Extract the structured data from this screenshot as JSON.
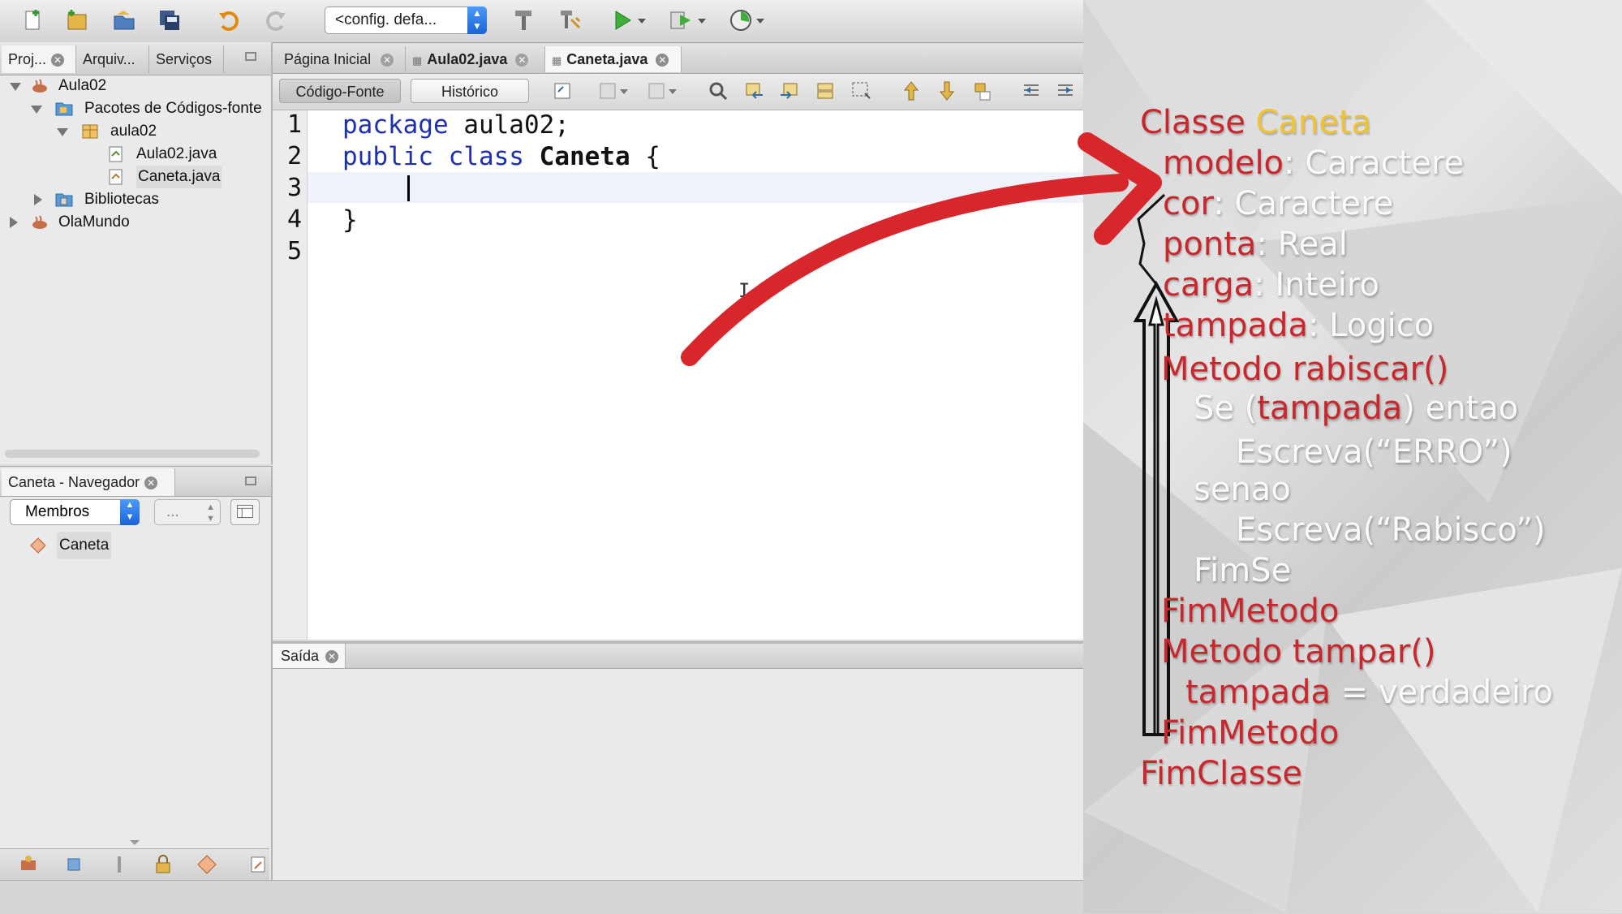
{
  "toolbar": {
    "config_select": "<config. defa...",
    "icons": [
      "new-file-icon",
      "new-project-icon",
      "open-project-icon",
      "save-all-icon",
      "undo-icon",
      "redo-icon",
      "build-icon",
      "clean-build-icon",
      "run-icon",
      "debug-icon",
      "profile-icon"
    ]
  },
  "projects_panel": {
    "tabs": [
      "Proj...",
      "Arquiv...",
      "Serviços"
    ],
    "tree": {
      "project1": "Aula02",
      "source_packages": "Pacotes de Códigos-fonte",
      "package": "aula02",
      "file1": "Aula02.java",
      "file2": "Caneta.java",
      "libraries": "Bibliotecas",
      "project2": "OlaMundo"
    }
  },
  "navigator": {
    "title": "Caneta - Navegador",
    "filter_select": "Membros",
    "second_select": "...",
    "item": "Caneta"
  },
  "editor": {
    "tabs": [
      "Página Inicial",
      "Aula02.java",
      "Caneta.java"
    ],
    "active_tab": "Caneta.java",
    "source_button": "Código-Fonte",
    "history_button": "Histórico",
    "line_numbers": [
      "1",
      "2",
      "3",
      "4",
      "5"
    ],
    "code": {
      "l1_kw": "package",
      "l1_rest": " aula02;",
      "l2_kw1": "public",
      "l2_kw2": "class",
      "l2_name": "Caneta",
      "l2_brace": " {",
      "l4": "}"
    }
  },
  "output": {
    "tab": "Saída"
  },
  "overlay": {
    "class_kw": "Classe",
    "class_name": "Caneta",
    "attrs": [
      {
        "name": "modelo",
        "type": ": Caractere"
      },
      {
        "name": "cor",
        "type": ": Caractere"
      },
      {
        "name": "ponta",
        "type": ": Real"
      },
      {
        "name": "carga",
        "type": ": Inteiro"
      },
      {
        "name": "tampada",
        "type": ": Logico"
      }
    ],
    "method1": "Metodo rabiscar()",
    "if_pre": "Se (",
    "if_var": "tampada",
    "if_post": ") entao",
    "write1": "Escreva(“ERRO”)",
    "else": "senao",
    "write2": "Escreva(“Rabisco”)",
    "endif": "FimSe",
    "endmethod1": "FimMetodo",
    "method2": "Metodo tampar()",
    "assign_var": "tampada",
    "assign_rest": " = verdadeiro",
    "endmethod2": "FimMetodo",
    "endclass": "FimClasse"
  },
  "colors": {
    "keyword": "#1f2fb2",
    "pseudocode_red": "#c8282d",
    "pseudocode_yellow": "#f1c232",
    "arrow_red": "#d8262d"
  }
}
